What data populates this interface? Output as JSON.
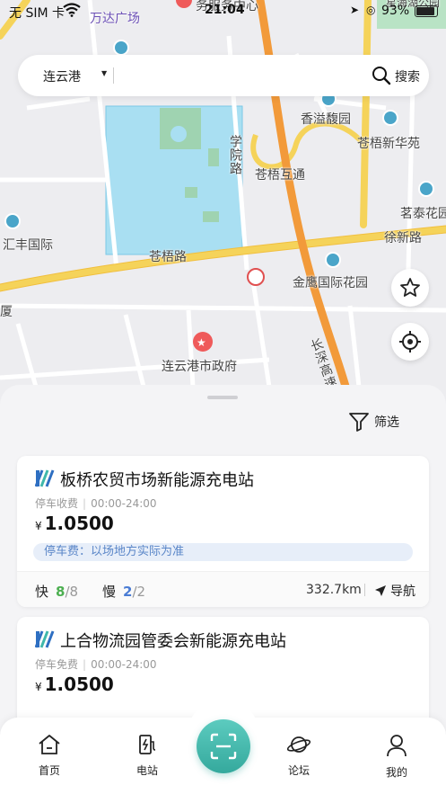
{
  "status_bar": {
    "carrier": "无 SIM 卡",
    "time": "21:04",
    "battery": "93%"
  },
  "map": {
    "labels": {
      "wanda": "万达广场",
      "service_center": "务服务中心",
      "xiangyi": "香溢馥园",
      "cangwu_xinhua": "苍梧新华苑",
      "xueyuan_road": "学院路",
      "cangwu_interchange": "苍梧互通",
      "chadong": "茗泰花园",
      "huifeng": "汇丰国际",
      "xinxin_road": "徐新路",
      "cangwu_road": "苍梧路",
      "jinying": "金鹰国际花园",
      "xia": "厦",
      "government": "连云港市政府",
      "changshen": "长深高速",
      "xinghai": "星海湖公园"
    }
  },
  "search": {
    "city": "连云港",
    "button": "搜索"
  },
  "sheet": {
    "filter_label": "筛选",
    "stations": [
      {
        "name": "板桥农贸市场新能源充电站",
        "parking": "停车收费",
        "hours": "00:00-24:00",
        "currency": "¥",
        "price": "1.0500",
        "note": "停车费：以场地方实际为准",
        "fast_label": "快",
        "fast_avail": "8",
        "fast_total": "/8",
        "slow_label": "慢",
        "slow_avail": "2",
        "slow_total": "/2",
        "distance": "332.7km",
        "nav_label": "导航"
      },
      {
        "name": "上合物流园管委会新能源充电站",
        "parking": "停车免费",
        "hours": "00:00-24:00",
        "currency": "¥",
        "price": "1.0500"
      }
    ]
  },
  "tabbar": {
    "items": [
      {
        "label": "首页",
        "icon": "home-icon"
      },
      {
        "label": "电站",
        "icon": "charging-station-icon"
      },
      {
        "label": "论坛",
        "icon": "planet-icon"
      },
      {
        "label": "我的",
        "icon": "person-icon"
      }
    ],
    "scan_icon": "scan-icon"
  },
  "colors": {
    "accent": "#3fb8ab",
    "fast_available": "#4caf50",
    "slow_available": "#4a7cd4",
    "note_bg": "#e7eef9"
  }
}
